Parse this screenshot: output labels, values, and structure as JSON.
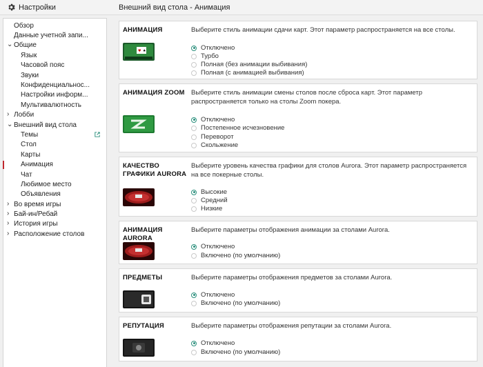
{
  "app": {
    "title": "Настройки",
    "page_title": "Внешний вид стола - Анимация"
  },
  "sidebar": {
    "items": [
      {
        "label": "Обзор"
      },
      {
        "label": "Данные учетной запи..."
      },
      {
        "label": "Общие",
        "arrow": "⌄"
      },
      {
        "label": "Язык"
      },
      {
        "label": "Часовой пояс"
      },
      {
        "label": "Звуки"
      },
      {
        "label": "Конфиденциальнос..."
      },
      {
        "label": "Настройки информ..."
      },
      {
        "label": "Мультивалютность"
      },
      {
        "label": "Лобби",
        "arrow": "›"
      },
      {
        "label": "Внешний вид стола",
        "arrow": "⌄"
      },
      {
        "label": "Темы"
      },
      {
        "label": "Стол"
      },
      {
        "label": "Карты"
      },
      {
        "label": "Анимация"
      },
      {
        "label": "Чат"
      },
      {
        "label": "Любимое место"
      },
      {
        "label": "Объявления"
      },
      {
        "label": "Во время игры",
        "arrow": "›"
      },
      {
        "label": "Бай-ин/Ребай",
        "arrow": "›"
      },
      {
        "label": "История игры",
        "arrow": "›"
      },
      {
        "label": "Расположение столов",
        "arrow": "›"
      }
    ]
  },
  "sections": [
    {
      "title": "АНИМАЦИЯ",
      "description": "Выберите стиль анимации сдачи карт. Этот параметр распространяется на все столы.",
      "options": [
        "Отключено",
        "Турбо",
        "Полная (без анимации выбивания)",
        "Полная (с анимацией выбивания)"
      ],
      "selected": 0
    },
    {
      "title": "АНИМАЦИЯ ZOOM",
      "description": "Выберите стиль анимации смены столов после сброса карт. Этот параметр распространяется только на столы Zoom покера.",
      "options": [
        "Отключено",
        "Постепенное исчезновение",
        "Переворот",
        "Скольжение"
      ],
      "selected": 0
    },
    {
      "title": "КАЧЕСТВО ГРАФИКИ AURORA",
      "description": "Выберите уровень качества графики для столов Aurora. Этот параметр распространяется на все покерные столы.",
      "options": [
        "Высокие",
        "Средний",
        "Низкие"
      ],
      "selected": 0
    },
    {
      "title": "АНИМАЦИЯ AURORA",
      "description": "Выберите параметры отображения анимации за столами Aurora.",
      "options": [
        "Отключено",
        "Включено (по умолчанию)"
      ],
      "selected": 0
    },
    {
      "title": "ПРЕДМЕТЫ",
      "description": "Выберите параметры отображения предметов за столами Aurora.",
      "options": [
        "Отключено",
        "Включено (по умолчанию)"
      ],
      "selected": 0
    },
    {
      "title": "РЕПУТАЦИЯ",
      "description": "Выберите параметры отображения репутации за столами Aurora.",
      "options": [
        "Отключено",
        "Включено (по умолчанию)"
      ],
      "selected": 0
    }
  ],
  "colors": {
    "accent": "#2a8f7c",
    "active_marker": "#c0272d"
  },
  "icons": {
    "app": "gear-icon",
    "themes_link": "external-link-icon"
  }
}
